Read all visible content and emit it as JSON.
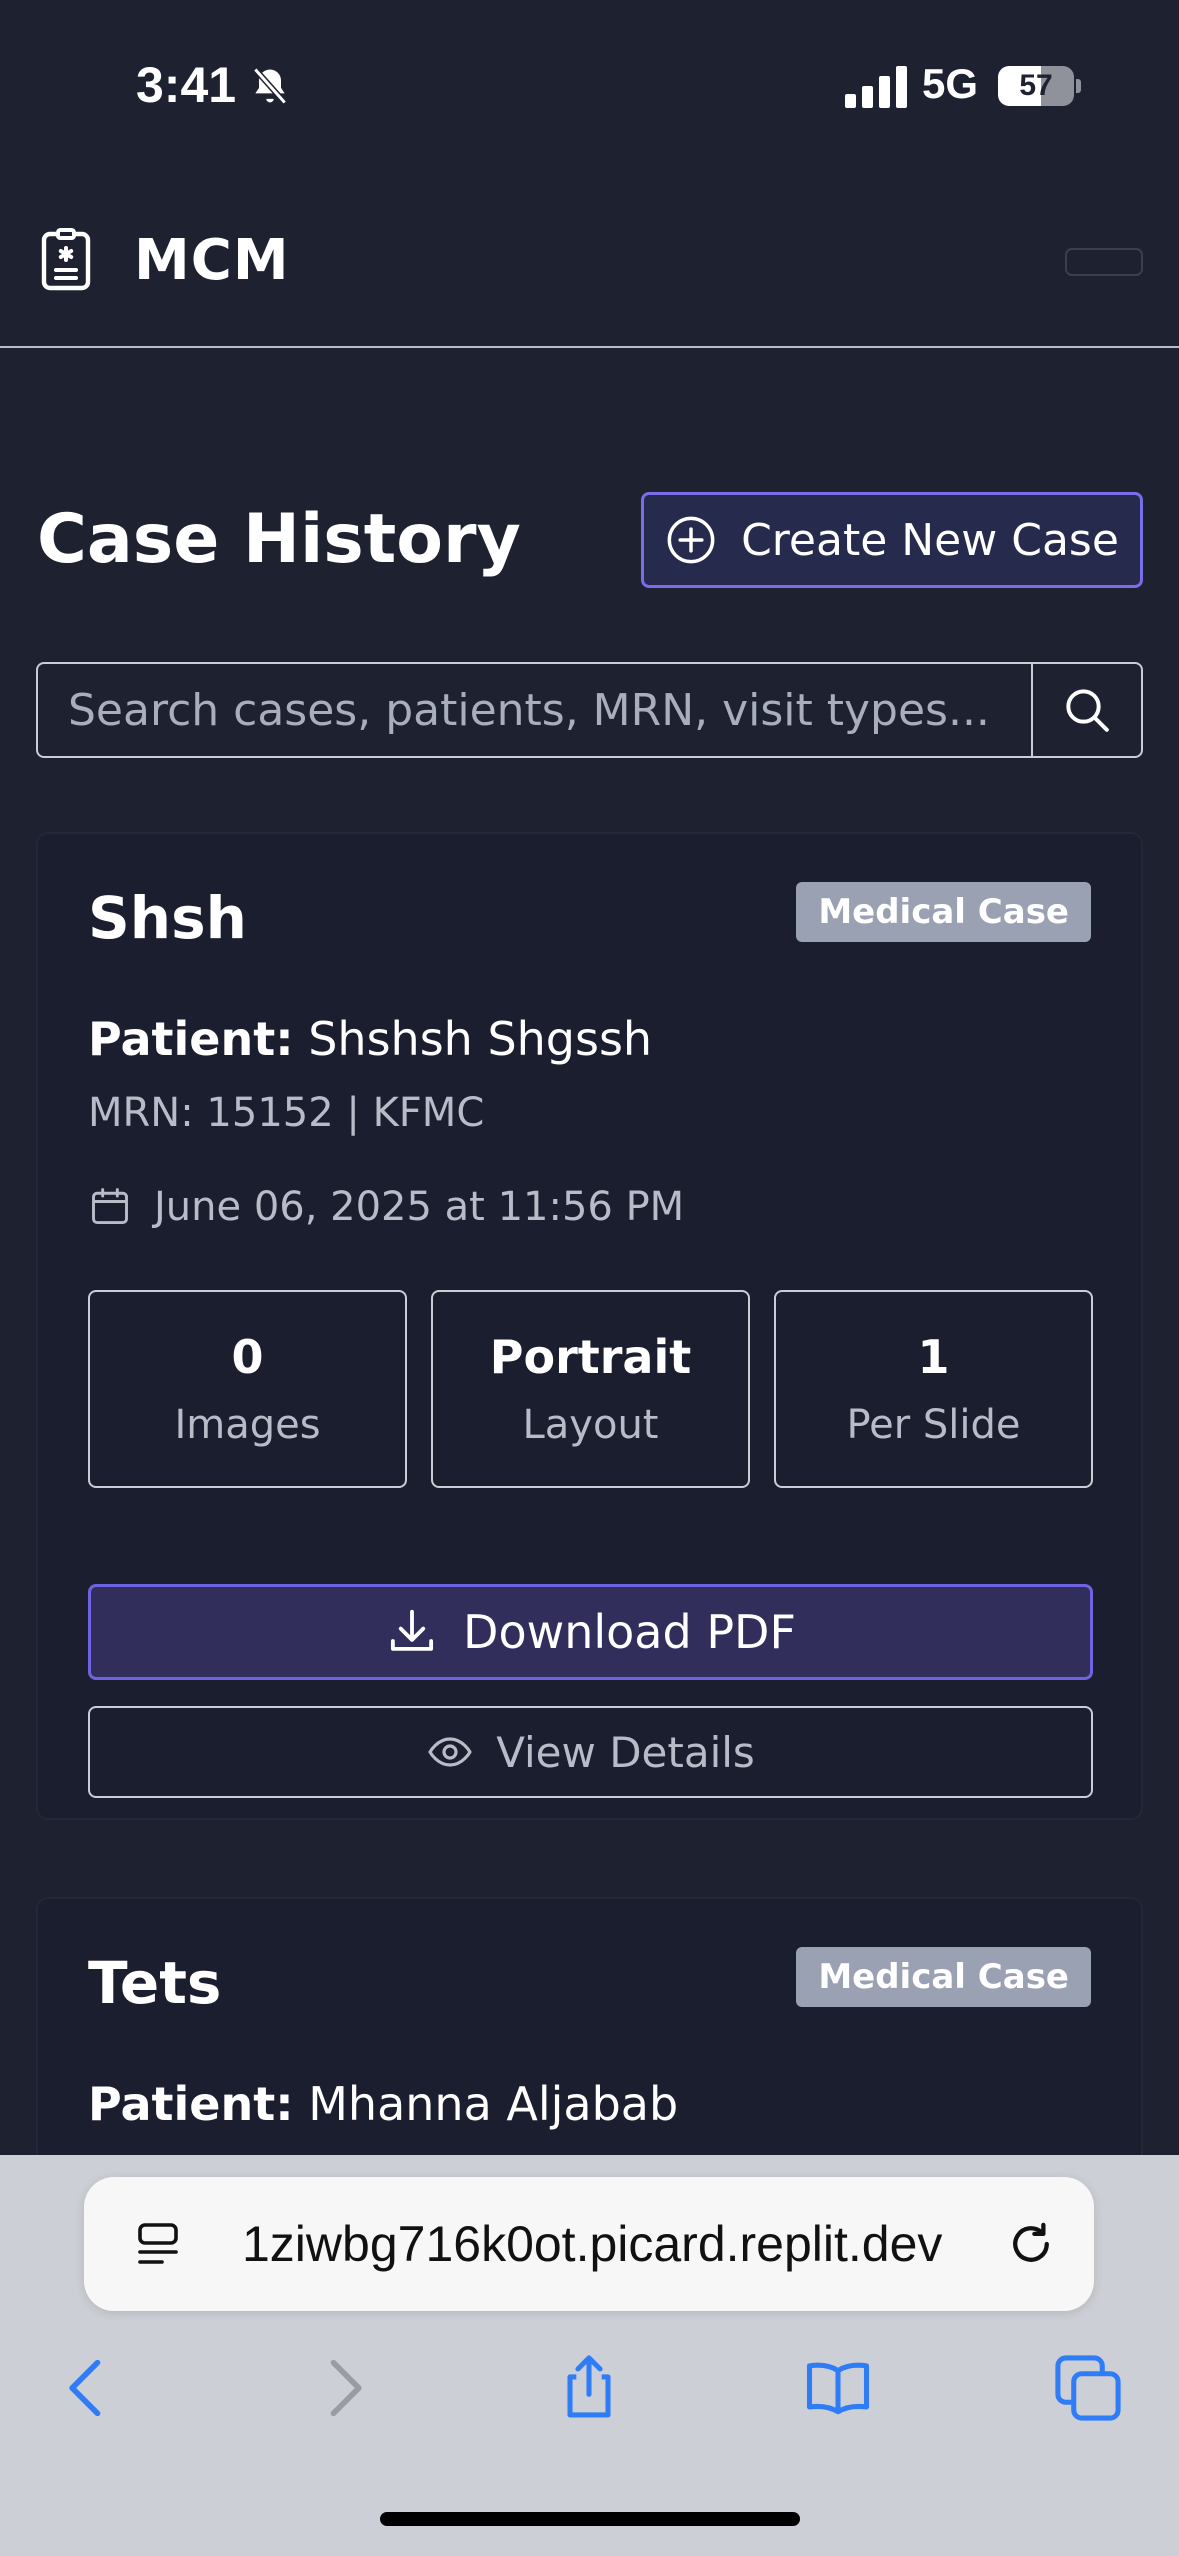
{
  "status_bar": {
    "time": "3:41",
    "network": "5G",
    "battery_percent": "57",
    "battery_level": 0.57
  },
  "header": {
    "app_title": "MCM"
  },
  "page": {
    "title": "Case History",
    "create_button_label": "Create New Case",
    "search_placeholder": "Search cases, patients, MRN, visit types..."
  },
  "cases": [
    {
      "title": "Shsh",
      "badge": "Medical Case",
      "patient_label": "Patient:",
      "patient_name": "Shshsh Shgssh",
      "mrn_line": "MRN: 15152 | KFMC",
      "date": "June 06, 2025 at 11:56 PM",
      "stats": [
        {
          "value": "0",
          "label": "Images"
        },
        {
          "value": "Portrait",
          "label": "Layout"
        },
        {
          "value": "1",
          "label": "Per Slide"
        }
      ],
      "download_label": "Download PDF",
      "view_label": "View Details"
    },
    {
      "title": "Tets",
      "badge": "Medical Case",
      "patient_label": "Patient:",
      "patient_name": "Mhanna Aljabab"
    }
  ],
  "browser": {
    "url": "1ziwbg716k0ot.picard.replit.dev",
    "accent_color": "#2f7df6"
  },
  "icons": {
    "logo": "medical-id-icon",
    "create": "plus-circle-icon",
    "search": "search-icon",
    "date": "calendar-icon",
    "download": "download-icon",
    "view": "eye-icon"
  }
}
